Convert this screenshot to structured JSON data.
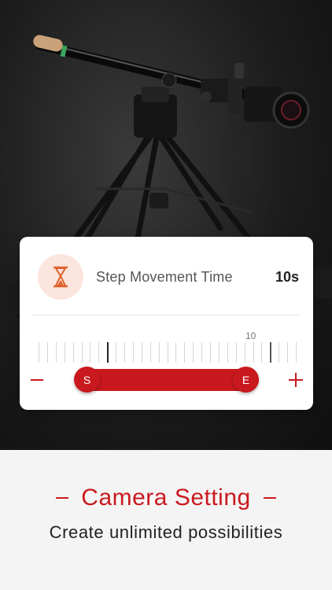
{
  "setting": {
    "label": "Step Movement Time",
    "value": "10s",
    "scale_label": "10",
    "start_handle": "S",
    "end_handle": "E",
    "selected_range": {
      "start_fraction": 0.12,
      "end_fraction": 0.88
    }
  },
  "footer": {
    "title": "Camera Setting",
    "subtitle": "Create unlimited possibilities"
  },
  "colors": {
    "accent": "#c9191e",
    "icon_bg": "#fbe5dd",
    "background": "#f5f4f4"
  },
  "icons": {
    "setting_icon": "hourglass-icon",
    "decrease": "minus-icon",
    "increase": "plus-icon"
  }
}
